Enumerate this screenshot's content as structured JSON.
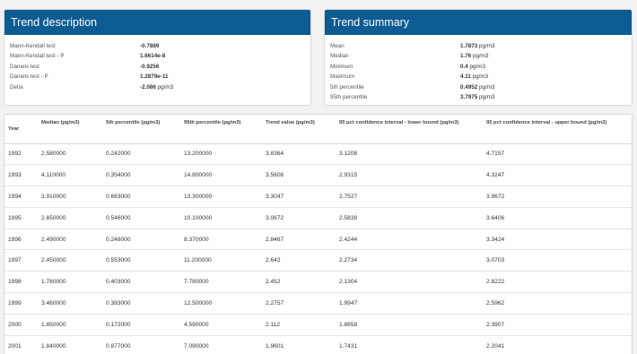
{
  "trend_description": {
    "title": "Trend description",
    "rows": [
      {
        "label": "Mann-Kendall test",
        "value": "-0.7889",
        "unit": ""
      },
      {
        "label": "Mann-Kendall test - P",
        "value": "1.6614e-8",
        "unit": ""
      },
      {
        "label": "Daniels test",
        "value": "-0.9256",
        "unit": ""
      },
      {
        "label": "Daniels test - P",
        "value": "1.2879e-11",
        "unit": ""
      },
      {
        "label": "Delta",
        "value": "-2.086",
        "unit": "pg/m3"
      }
    ]
  },
  "trend_summary": {
    "title": "Trend summary",
    "rows": [
      {
        "label": "Mean",
        "value": "1.7873",
        "unit": "pg/m3"
      },
      {
        "label": "Median",
        "value": "1.76",
        "unit": "pg/m3"
      },
      {
        "label": "Minimum",
        "value": "0.4",
        "unit": "pg/m3"
      },
      {
        "label": "Maximum",
        "value": "4.11",
        "unit": "pg/m3"
      },
      {
        "label": "5th percentile",
        "value": "0.4952",
        "unit": "pg/m3"
      },
      {
        "label": "95th percentile",
        "value": "3.7975",
        "unit": "pg/m3"
      }
    ]
  },
  "table": {
    "headers": [
      "Year",
      "Median (pg/m3)",
      "5th percentile (pg/m3)",
      "95th percentile (pg/m3)",
      "Trend value (pg/m3)",
      "95 pct confidence interval - lower bound (pg/m3)",
      "95 pct confidence interval - upper bound (pg/m3)"
    ],
    "rows": [
      [
        "1992",
        "2.580000",
        "0.242000",
        "13.200000",
        "3.8364",
        "3.1208",
        "4.7157"
      ],
      [
        "1993",
        "4.110000",
        "0.354000",
        "14.800000",
        "3.5606",
        "2.9315",
        "4.3247"
      ],
      [
        "1994",
        "3.910000",
        "0.663000",
        "13.300000",
        "3.3047",
        "2.7527",
        "3.9672"
      ],
      [
        "1995",
        "2.650000",
        "0.546000",
        "10.100000",
        "3.0672",
        "2.5839",
        "3.6406"
      ],
      [
        "1996",
        "2.490000",
        "0.248000",
        "8.370000",
        "2.8467",
        "2.4244",
        "3.3424"
      ],
      [
        "1997",
        "2.450000",
        "0.553000",
        "11.200000",
        "2.642",
        "2.2734",
        "3.0703"
      ],
      [
        "1998",
        "1.780000",
        "0.403000",
        "7.780000",
        "2.452",
        "2.1304",
        "2.8222"
      ],
      [
        "1999",
        "3.460000",
        "0.393000",
        "12.500000",
        "2.2757",
        "1.9947",
        "2.5962"
      ],
      [
        "2000",
        "1.850000",
        "0.172000",
        "4.590000",
        "2.112",
        "1.8658",
        "2.3907"
      ],
      [
        "2001",
        "1.840000",
        "0.877000",
        "7.090000",
        "1.9601",
        "1.7431",
        "2.2041"
      ]
    ]
  }
}
